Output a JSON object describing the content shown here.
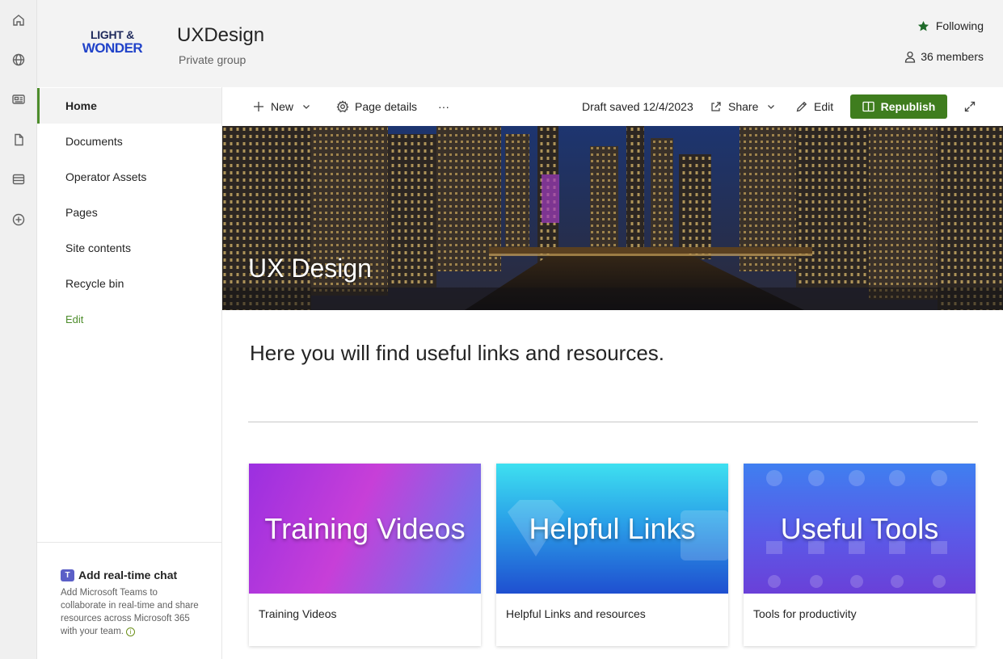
{
  "rail": {
    "items": [
      {
        "name": "home-icon"
      },
      {
        "name": "globe-icon"
      },
      {
        "name": "news-icon"
      },
      {
        "name": "document-icon"
      },
      {
        "name": "list-icon"
      },
      {
        "name": "add-circle-icon"
      }
    ]
  },
  "header": {
    "logo_line1": "LIGHT &",
    "logo_line2": "WONDER",
    "title": "UXDesign",
    "subtitle": "Private group",
    "following": "Following",
    "members": "36 members"
  },
  "nav": {
    "items": [
      {
        "label": "Home",
        "active": true
      },
      {
        "label": "Documents"
      },
      {
        "label": "Operator Assets"
      },
      {
        "label": "Pages"
      },
      {
        "label": "Site contents"
      },
      {
        "label": "Recycle bin"
      }
    ],
    "edit_label": "Edit",
    "chat_title": "Add real-time chat",
    "chat_desc": "Add Microsoft Teams to collaborate in real-time and share resources across Microsoft 365 with your team."
  },
  "cmdbar": {
    "new_label": "New",
    "page_details_label": "Page details",
    "more_label": "···",
    "draft_status": "Draft saved 12/4/2023",
    "share_label": "Share",
    "edit_label": "Edit",
    "republish_label": "Republish"
  },
  "hero": {
    "title": "UX Design"
  },
  "content": {
    "intro": "Here you will find useful links and resources."
  },
  "cards": [
    {
      "image_text": "Training Videos",
      "caption": "Training Videos"
    },
    {
      "image_text": "Helpful Links",
      "caption": "Helpful Links and resources"
    },
    {
      "image_text": "Useful Tools",
      "caption": "Tools for productivity"
    }
  ],
  "colors": {
    "accent": "#3f7d1e",
    "nav_active_bar": "#4e8d2c",
    "star": "#1f6b2a"
  }
}
